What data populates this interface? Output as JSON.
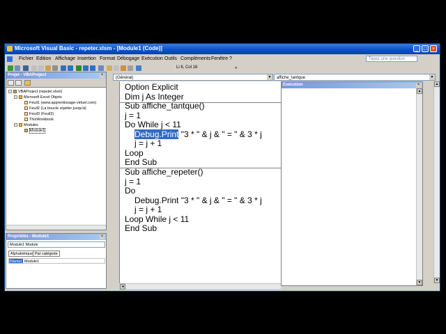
{
  "window": {
    "title": "Microsoft Visual Basic - repeter.xlsm - [Module1 (Code)]"
  },
  "menu": {
    "items": [
      "Fichier",
      "Edition",
      "Affichage",
      "Insertion",
      "Format",
      "Débogage",
      "Exécution",
      "Outils",
      "Compléments",
      "Fenêtre",
      "?"
    ],
    "help_placeholder": "Tapez une question"
  },
  "toolbar": {
    "position": "Li 6, Col 16"
  },
  "project_panel": {
    "title": "Projet - VBAProject",
    "tree": [
      "VBAProject (repeter.xlsm)",
      "Microsoft Excel Objets",
      "Feuil1 (www.apprentissage-virtuel.com)",
      "Feuil2 (La boucle répéter jusqu'à)",
      "Feuil3 (Feuil3)",
      "ThisWorkbook",
      "Modules",
      "Module1"
    ]
  },
  "properties_panel": {
    "title": "Propriétés - Module1",
    "object_select": "Module1 Module",
    "tabs": [
      "Alphabétique",
      "Par catégorie"
    ],
    "row_key": "(Name)",
    "row_value": "Module1"
  },
  "code_window": {
    "object_combo": "(Général)",
    "proc_combo": "affiche_tantque",
    "lines": {
      "l1": "Option Explicit",
      "l2": "Dim j As Integer",
      "l3": "Sub affiche_tantque()",
      "l4": "j = 1",
      "l5": "Do While j < 11",
      "l6_sel": "Debug.Print",
      "l6_rest": " \"3 * \" & j & \" = \" & 3 * j",
      "l7": "j = j + 1",
      "l8": "Loop",
      "l9": "End Sub",
      "l10": "Sub affiche_repeter()",
      "l11": "j = 1",
      "l12": "Do",
      "l13": "Debug.Print \"3 * \" & j & \" = \" & 3 * j",
      "l14": "j = j + 1",
      "l15": "Loop While j < 11",
      "l16": "End Sub"
    }
  },
  "immediate_window": {
    "title": "Exécution"
  }
}
